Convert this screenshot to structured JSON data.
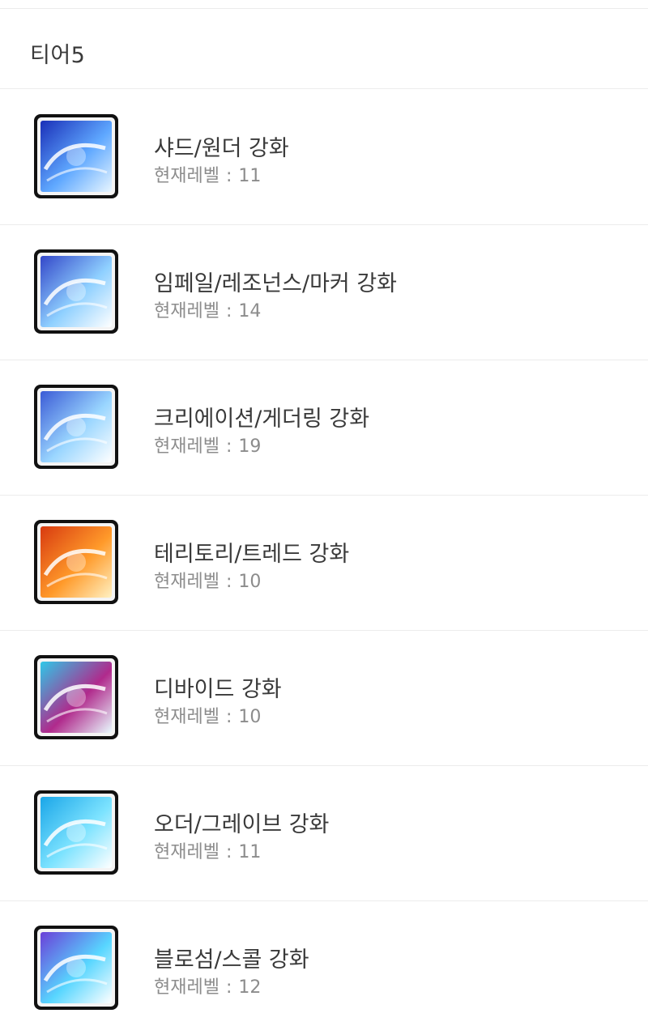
{
  "section": {
    "title": "티어5"
  },
  "level_label": "현재레벨",
  "level_separator": ":",
  "skills": [
    {
      "name": "샤드/원더 강화",
      "level": "11",
      "icon": "shard-wonder-skill-icon",
      "colors": [
        "#1a2fb8",
        "#5fa8ff",
        "#e8f6ff"
      ]
    },
    {
      "name": "임페일/레조넌스/마커 강화",
      "level": "14",
      "icon": "impale-resonance-marker-skill-icon",
      "colors": [
        "#3347c9",
        "#8fd0ff",
        "#ffffff"
      ]
    },
    {
      "name": "크리에이션/게더링 강화",
      "level": "19",
      "icon": "creation-gathering-skill-icon",
      "colors": [
        "#3b5bd6",
        "#9ad6ff",
        "#ffffff"
      ]
    },
    {
      "name": "테리토리/트레드 강화",
      "level": "10",
      "icon": "territory-tread-skill-icon",
      "colors": [
        "#d83a10",
        "#ff9a2a",
        "#fff1c2"
      ]
    },
    {
      "name": "디바이드 강화",
      "level": "10",
      "icon": "divide-skill-icon",
      "colors": [
        "#2ec8e8",
        "#b02a8c",
        "#e9fbff"
      ]
    },
    {
      "name": "오더/그레이브 강화",
      "level": "11",
      "icon": "order-grave-skill-icon",
      "colors": [
        "#1aa6e8",
        "#7de3ff",
        "#ffffff"
      ]
    },
    {
      "name": "블로섬/스콜 강화",
      "level": "12",
      "icon": "blossom-scool-skill-icon",
      "colors": [
        "#6a3fd8",
        "#58d6ff",
        "#ffffff"
      ]
    }
  ]
}
